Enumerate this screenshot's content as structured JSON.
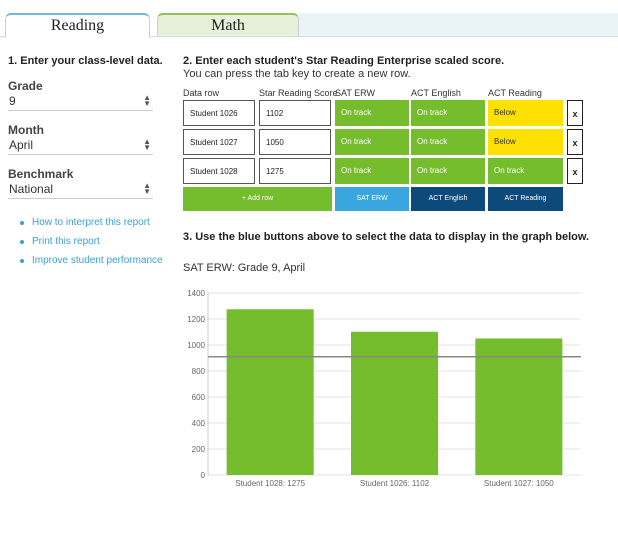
{
  "tabs": [
    {
      "label": "Reading",
      "active": true
    },
    {
      "label": "Math",
      "active": false
    }
  ],
  "left": {
    "step1": "1. Enter your class-level data.",
    "grade": {
      "label": "Grade",
      "value": "9"
    },
    "month": {
      "label": "Month",
      "value": "April"
    },
    "benchmark": {
      "label": "Benchmark",
      "value": "National"
    },
    "links": [
      "How to interpret this report",
      "Print this report",
      "Improve student performance"
    ]
  },
  "right": {
    "step2": "2. Enter each student's Star Reading Enterprise scaled score.",
    "step2_sub": "You can press the tab key to create a new row.",
    "columns": [
      "Data row",
      "Star Reading Score",
      "SAT ERW",
      "ACT English",
      "ACT Reading"
    ],
    "rows": [
      {
        "name": "Student 1026",
        "score": "1102",
        "sat": "On track",
        "act_english": "On track",
        "act_reading": "Below",
        "remove": "x"
      },
      {
        "name": "Student 1027",
        "score": "1050",
        "sat": "On track",
        "act_english": "On track",
        "act_reading": "Below",
        "remove": "x"
      },
      {
        "name": "Student 1028",
        "score": "1275",
        "sat": "On track",
        "act_english": "On track",
        "act_reading": "On track",
        "remove": "x"
      }
    ],
    "buttons": {
      "add_row": "+ Add row",
      "sat": "SAT ERW",
      "act_english": "ACT English",
      "act_reading": "ACT Reading"
    },
    "step3": "3. Use the blue buttons above to select the data to display in the graph below."
  },
  "colors": {
    "on_track": "#76bd2d",
    "below": "#ffe100",
    "sat_button": "#3aa6e0",
    "act_button": "#0d4a7c",
    "benchmark_line": "#888888"
  },
  "chart_data": {
    "type": "bar",
    "title": "SAT ERW: Grade 9, April",
    "categories": [
      "Student 1028: 1275",
      "Student 1026: 1102",
      "Student 1027: 1050"
    ],
    "values": [
      1275,
      1102,
      1050
    ],
    "benchmark": 910,
    "ylim": [
      0,
      1400
    ],
    "yticks": [
      0,
      200,
      400,
      600,
      800,
      1000,
      1200,
      1400
    ],
    "grid": true,
    "bar_color": "#76bd2d"
  }
}
